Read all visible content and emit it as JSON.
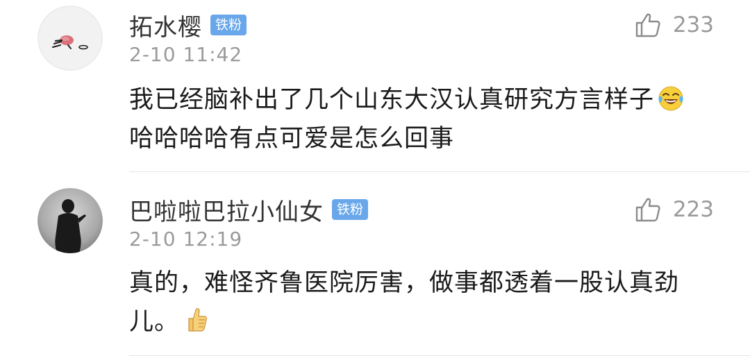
{
  "comments": [
    {
      "username": "拓水樱",
      "badge": "铁粉",
      "timestamp": "2-10 11:42",
      "likes": "233",
      "text_before": "我已经脑补出了几个山东大汉认真研究方言样子",
      "emoji": "laughing-tears-emoji",
      "text_after": "哈哈哈哈有点可爱是怎么回事"
    },
    {
      "username": "巴啦啦巴拉小仙女",
      "badge": "铁粉",
      "timestamp": "2-10 12:19",
      "likes": "223",
      "text_before": "真的，难怪齐鲁医院厉害，做事都透着一股认真劲儿。",
      "emoji": "thumbs-up-emoji",
      "text_after": ""
    }
  ],
  "colors": {
    "badge": "#69a7ea",
    "meta_text": "#9a9a9a",
    "body_text": "#1a1a1a",
    "username": "#333333"
  }
}
